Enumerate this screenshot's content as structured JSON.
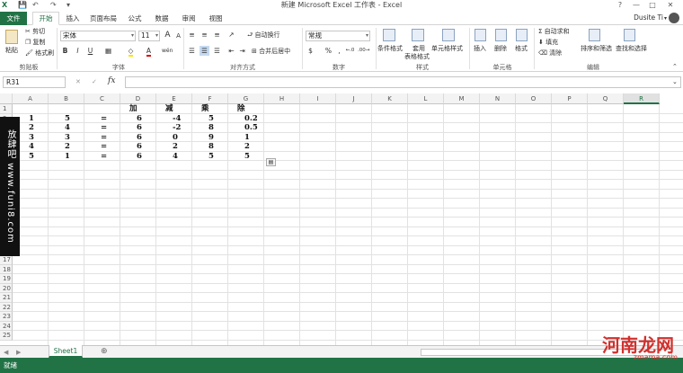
{
  "window": {
    "title": "新建 Microsoft Excel 工作表 - Excel",
    "help": "?",
    "minimize": "—",
    "restore": "□",
    "close": "✕"
  },
  "qat": {
    "save": "💾",
    "undo": "↶",
    "redo": "↷",
    "customize": "▾"
  },
  "tabs": [
    "文件",
    "开始",
    "插入",
    "页面布局",
    "公式",
    "数据",
    "审阅",
    "视图"
  ],
  "user": {
    "name": "Dusite Ti",
    "menu": "▾"
  },
  "ribbon": {
    "clipboard": {
      "paste": "粘贴",
      "cut": "剪切",
      "copy": "复制",
      "format_painter": "格式刷",
      "label": "剪贴板"
    },
    "font": {
      "name": "宋体",
      "size": "11",
      "grow": "A",
      "shrink": "A",
      "bold": "B",
      "italic": "I",
      "underline": "U",
      "font_color_glyph": "A",
      "phonetic": "wén",
      "label": "字体"
    },
    "alignment": {
      "wrap": "自动换行",
      "merge": "合并后居中",
      "label": "对齐方式"
    },
    "number": {
      "format": "常规",
      "currency": "$",
      "percent": "%",
      "comma": ",",
      "inc_decimal": "←.0",
      "dec_decimal": ".00→",
      "label": "数字"
    },
    "styles": {
      "conditional": "条件格式",
      "table_line1": "套用",
      "table_line2": "表格格式",
      "cell_styles": "单元格样式",
      "label": "样式"
    },
    "cells": {
      "insert": "插入",
      "delete": "删除",
      "format": "格式",
      "label": "单元格"
    },
    "editing": {
      "autosum": "自动求和",
      "fill": "填充",
      "clear": "清除",
      "sort": "排序和筛选",
      "find": "查找和选择",
      "label": "编辑"
    }
  },
  "formula_bar": {
    "name_box": "R31",
    "cancel": "✕",
    "enter": "✓",
    "fx": "fx",
    "value": "",
    "expand": "⌄"
  },
  "columns": [
    "A",
    "B",
    "C",
    "D",
    "E",
    "F",
    "G",
    "H",
    "I",
    "J",
    "K",
    "L",
    "M",
    "N",
    "O",
    "P",
    "Q",
    "R"
  ],
  "selected_column": "R",
  "rows": [
    "1",
    "2",
    "3",
    "4",
    "5",
    "6",
    "7",
    "8",
    "9",
    "10",
    "11",
    "12",
    "13",
    "14",
    "15",
    "16",
    "17",
    "18",
    "19",
    "20",
    "21",
    "22",
    "23",
    "24",
    "25"
  ],
  "cells": [
    {
      "ref": "D1",
      "value": "加"
    },
    {
      "ref": "E1",
      "value": "减"
    },
    {
      "ref": "F1",
      "value": "乘"
    },
    {
      "ref": "G1",
      "value": "除"
    },
    {
      "ref": "A2",
      "value": "1"
    },
    {
      "ref": "B2",
      "value": "5"
    },
    {
      "ref": "C2",
      "value": "="
    },
    {
      "ref": "D2",
      "value": "6"
    },
    {
      "ref": "E2",
      "value": "-4"
    },
    {
      "ref": "F2",
      "value": "5"
    },
    {
      "ref": "G2",
      "value": "0.2"
    },
    {
      "ref": "A3",
      "value": "2"
    },
    {
      "ref": "B3",
      "value": "4"
    },
    {
      "ref": "C3",
      "value": "="
    },
    {
      "ref": "D3",
      "value": "6"
    },
    {
      "ref": "E3",
      "value": "-2"
    },
    {
      "ref": "F3",
      "value": "8"
    },
    {
      "ref": "G3",
      "value": "0.5"
    },
    {
      "ref": "A4",
      "value": "3"
    },
    {
      "ref": "B4",
      "value": "3"
    },
    {
      "ref": "C4",
      "value": "="
    },
    {
      "ref": "D4",
      "value": "6"
    },
    {
      "ref": "E4",
      "value": "0"
    },
    {
      "ref": "F4",
      "value": "9"
    },
    {
      "ref": "G4",
      "value": "1"
    },
    {
      "ref": "A5",
      "value": "4"
    },
    {
      "ref": "B5",
      "value": "2"
    },
    {
      "ref": "C5",
      "value": "="
    },
    {
      "ref": "D5",
      "value": "6"
    },
    {
      "ref": "E5",
      "value": "2"
    },
    {
      "ref": "F5",
      "value": "8"
    },
    {
      "ref": "G5",
      "value": "2"
    },
    {
      "ref": "A6",
      "value": "5"
    },
    {
      "ref": "B6",
      "value": "1"
    },
    {
      "ref": "C6",
      "value": "="
    },
    {
      "ref": "D6",
      "value": "6"
    },
    {
      "ref": "E6",
      "value": "4"
    },
    {
      "ref": "F6",
      "value": "5"
    },
    {
      "ref": "G6",
      "value": "5"
    }
  ],
  "sheet": {
    "name": "Sheet1",
    "add": "⊕",
    "prev": "◀",
    "next": "▶"
  },
  "status": {
    "mode": "就绪"
  },
  "watermark": {
    "left_text": "放肆吧 www.funi8.com",
    "brand": "河南龙网",
    "brand_sub": "zmama.com"
  },
  "colors": {
    "accent": "#217346",
    "grid_line": "#e2e2e2",
    "header_bg": "#f3f3f3"
  }
}
